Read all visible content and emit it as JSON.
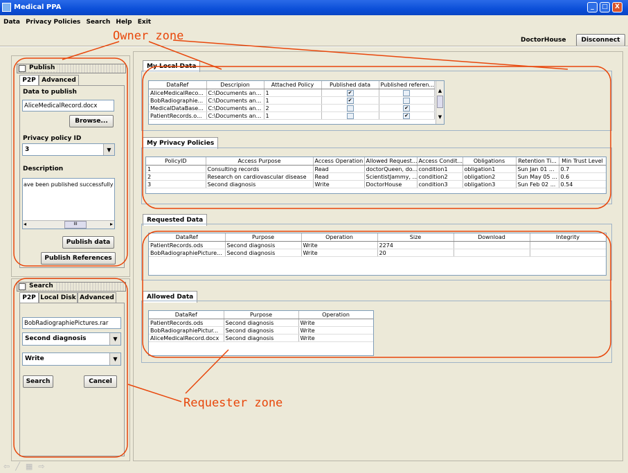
{
  "window": {
    "title": "Medical PPA",
    "minimize": "_",
    "maximize": "□",
    "close": "X"
  },
  "menu": [
    "Data",
    "Privacy Policies",
    "Search",
    "Help",
    "Exit"
  ],
  "user": {
    "name": "DoctorHouse",
    "disconnect": "Disconnect"
  },
  "publish": {
    "panel_title": "Publish",
    "tabs": [
      "P2P",
      "Advanced"
    ],
    "data_label": "Data to publish",
    "file_value": "AliceMedicalRecord.docx",
    "browse": "Browse...",
    "policy_label": "Privacy policy ID",
    "policy_value": "3",
    "description_label": "Description",
    "description_value": "ave been published successfully",
    "scroll_mid": "III",
    "publish_data": "Publish data",
    "publish_refs": "Publish References"
  },
  "search": {
    "panel_title": "Search",
    "tabs": [
      "P2P",
      "Local Disk",
      "Advanced"
    ],
    "query": "BobRadiographiePictures.rar",
    "purpose": "Second diagnosis",
    "operation": "Write",
    "search_btn": "Search",
    "cancel_btn": "Cancel"
  },
  "local_data": {
    "tab": "My Local Data",
    "headers": [
      "DataRef",
      "Descripion",
      "Attached Policy",
      "Published data",
      "Published referen..."
    ],
    "rows": [
      {
        "ref": "AliceMedicalReco...",
        "desc": "C:\\Documents an...",
        "policy": "1",
        "pub": true,
        "pubref": false
      },
      {
        "ref": "BobRadiographie...",
        "desc": "C:\\Documents an...",
        "policy": "1",
        "pub": true,
        "pubref": false
      },
      {
        "ref": "MedicalDataBase...",
        "desc": "C:\\Documents an...",
        "policy": "2",
        "pub": false,
        "pubref": true
      },
      {
        "ref": "PatientRecords.o...",
        "desc": "C:\\Documents an...",
        "policy": "1",
        "pub": false,
        "pubref": true
      }
    ]
  },
  "policies": {
    "tab": "My Privacy Policies",
    "headers": [
      "PolicyID",
      "Access Purpose",
      "Access Operation",
      "Allowed Request...",
      "Access Condit...",
      "Obligations",
      "Retention Ti...",
      "Min Trust Level"
    ],
    "rows": [
      [
        "1",
        "Consulting records",
        "Read",
        "doctorQueen, do...",
        "condition1",
        "obligation1",
        "Sun Jan 01 ...",
        "0.7"
      ],
      [
        "2",
        "Research on cardiovascular disease",
        "Read",
        "ScientistJammy, ...",
        "condition2",
        "obligation2",
        "Sun May 05 ...",
        "0.6"
      ],
      [
        "3",
        "Second diagnosis",
        "Write",
        "DoctorHouse",
        "condition3",
        "obligation3",
        "Sun Feb 02 ...",
        "0.54"
      ]
    ]
  },
  "requested": {
    "tab": "Requested Data",
    "headers": [
      "DataRef",
      "Purpose",
      "Operation",
      "Size",
      "Download",
      "Integrity"
    ],
    "rows": [
      [
        "PatientRecords.ods",
        "Second diagnosis",
        "Write",
        "2274",
        "",
        ""
      ],
      [
        "BobRadiographiePicture...",
        "Second diagnosis",
        "Write",
        "20",
        "",
        ""
      ]
    ]
  },
  "allowed": {
    "tab": "Allowed Data",
    "headers": [
      "DataRef",
      "Purpose",
      "Operation"
    ],
    "rows": [
      [
        "PatientRecords.ods",
        "Second diagnosis",
        "Write"
      ],
      [
        "BobRadiographiePictur...",
        "Second diagnosis",
        "Write"
      ],
      [
        "AliceMedicalRecord.docx",
        "Second diagnosis",
        "Write"
      ]
    ]
  },
  "annotations": {
    "owner": "Owner zone",
    "requester": "Requester zone",
    "color": "#e8460a"
  }
}
